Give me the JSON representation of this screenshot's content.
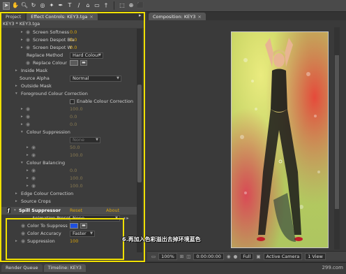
{
  "colors": {
    "accent": "#d9a40a",
    "highlight": "#f0e000",
    "swatch": "#1f4fe0"
  },
  "toolbar": {
    "icons": [
      "selection-tool-icon",
      "hand-tool-icon",
      "zoom-tool-icon",
      "rotate-tool-icon",
      "camera-orbit-icon",
      "pan-behind-icon",
      "pen-tool-icon",
      "text-tool-icon",
      "brush-tool-icon",
      "clone-stamp-icon",
      "eraser-icon",
      "puppet-tool-icon",
      "local-axis-icon",
      "world-axis-icon",
      "view-axis-icon"
    ]
  },
  "left_tabs": {
    "project": "Project",
    "effect_controls": "Effect Controls: KEY3.tga"
  },
  "crumb": "KEY3 * KEY3.tga",
  "effect_rows": [
    {
      "label": "Screen Softness",
      "value": "0.0"
    },
    {
      "label": "Screen Despot Bla",
      "value": "0.0"
    },
    {
      "label": "Screen Despot W",
      "value": "0.0"
    },
    {
      "label": "Replace Method",
      "dropdown": "Hard Colour"
    },
    {
      "label": "Replace Colour"
    },
    {
      "label": "Inside Mask"
    },
    {
      "label": "Source Alpha",
      "dropdown": "Normal"
    },
    {
      "label": "Outside Mask"
    },
    {
      "label": "Foreground Colour Correction"
    },
    {
      "label": "Enable Colour Correction"
    },
    {
      "label": "",
      "value": "100.0"
    },
    {
      "label": "",
      "value": "0.0"
    },
    {
      "label": "",
      "value": "0.0"
    },
    {
      "label": "Colour Suppression"
    },
    {
      "label": "",
      "dropdown": "None"
    },
    {
      "label": "",
      "value": "50.0"
    },
    {
      "label": "",
      "value": "100.0"
    },
    {
      "label": "Colour Balancing"
    },
    {
      "label": "",
      "value": "0.0"
    },
    {
      "label": "",
      "value": "100.0"
    },
    {
      "label": "",
      "value": "100.0"
    },
    {
      "label": "Edge Colour Correction"
    },
    {
      "label": "Source Crops"
    }
  ],
  "spill": {
    "name": "Spill Suppressor",
    "reset": "Reset",
    "about": "About",
    "presets_label": "Animation Presets:",
    "presets_value": "None",
    "color_label": "Color To Suppress",
    "accuracy_label": "Color Accuracy",
    "accuracy_value": "Faster",
    "suppression_label": "Suppression",
    "suppression_value": "100"
  },
  "viewer": {
    "tab": "Composition: KEY3",
    "zoom": "100%",
    "timecode": "0:00:00:00",
    "resolution": "Full",
    "camera": "Active Camera",
    "views": "1 View"
  },
  "overlay_text": "6.再加入色彩溢出去掉环境蓝色",
  "bottom_tabs": {
    "render_queue": "Render Queue",
    "timeline": "Timeline: KEY3"
  },
  "watermark": "299.com"
}
